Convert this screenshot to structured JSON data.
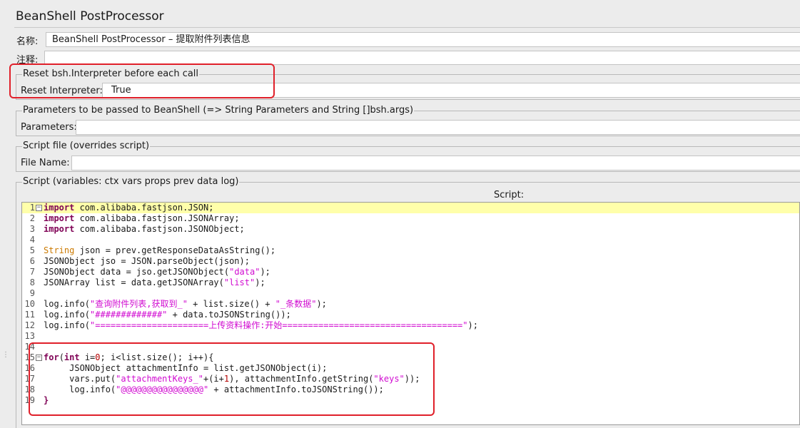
{
  "panel": {
    "title": "BeanShell PostProcessor"
  },
  "name_field": {
    "label": "名称:",
    "value": "BeanShell PostProcessor – 提取附件列表信息"
  },
  "comment_field": {
    "label": "注释:",
    "value": ""
  },
  "reset_group": {
    "title": "Reset bsh.Interpreter before each call",
    "label": "Reset Interpreter:",
    "value": "True"
  },
  "params_group": {
    "title": "Parameters to be passed to BeanShell (=> String Parameters and String []bsh.args)",
    "label": "Parameters:",
    "value": ""
  },
  "file_group": {
    "title": "Script file (overrides script)",
    "label": "File Name:",
    "value": ""
  },
  "script_group": {
    "title": "Script (variables: ctx vars props prev data log)",
    "script_label": "Script:"
  },
  "script_lines": [
    {
      "n": "1",
      "fold": "⊟",
      "tokens": [
        [
          "kw",
          "import"
        ],
        [
          "t",
          " com.alibaba.fastjson.JSON;"
        ]
      ]
    },
    {
      "n": "2",
      "tokens": [
        [
          "kw",
          "import"
        ],
        [
          "t",
          " com.alibaba.fastjson.JSONArray;"
        ]
      ]
    },
    {
      "n": "3",
      "tokens": [
        [
          "kw",
          "import"
        ],
        [
          "t",
          " com.alibaba.fastjson.JSONObject;"
        ]
      ]
    },
    {
      "n": "4",
      "tokens": []
    },
    {
      "n": "5",
      "tokens": [
        [
          "type",
          "String"
        ],
        [
          "t",
          " json = prev.getResponseDataAsString();"
        ]
      ]
    },
    {
      "n": "6",
      "tokens": [
        [
          "t",
          "JSONObject jso = JSON.parseObject(json);"
        ]
      ]
    },
    {
      "n": "7",
      "tokens": [
        [
          "t",
          "JSONObject data = jso.getJSONObject("
        ],
        [
          "str",
          "\"data\""
        ],
        [
          "t",
          ");"
        ]
      ]
    },
    {
      "n": "8",
      "tokens": [
        [
          "t",
          "JSONArray list = data.getJSONArray("
        ],
        [
          "str",
          "\"list\""
        ],
        [
          "t",
          ");"
        ]
      ]
    },
    {
      "n": "9",
      "tokens": []
    },
    {
      "n": "10",
      "tokens": [
        [
          "t",
          "log.info("
        ],
        [
          "str",
          "\"查询附件列表,获取到_\""
        ],
        [
          "t",
          " + list.size() + "
        ],
        [
          "str",
          "\"_条数据\""
        ],
        [
          "t",
          ");"
        ]
      ]
    },
    {
      "n": "11",
      "tokens": [
        [
          "t",
          "log.info("
        ],
        [
          "str",
          "\"#############\""
        ],
        [
          "t",
          " + data.toJSONString());"
        ]
      ]
    },
    {
      "n": "12",
      "tokens": [
        [
          "t",
          "log.info("
        ],
        [
          "str",
          "\"======================上传资料操作:开始===================================\""
        ],
        [
          "t",
          ");"
        ]
      ]
    },
    {
      "n": "13",
      "tokens": []
    },
    {
      "n": "14",
      "tokens": []
    },
    {
      "n": "15",
      "fold": "⊟",
      "tokens": [
        [
          "kw",
          "for"
        ],
        [
          "t",
          "("
        ],
        [
          "kw",
          "int"
        ],
        [
          "t",
          " i="
        ],
        [
          "num",
          "0"
        ],
        [
          "t",
          "; i<list.size(); i++){"
        ]
      ]
    },
    {
      "n": "16",
      "tokens": [
        [
          "t",
          "     JSONObject attachmentInfo = list.getJSONObject(i);"
        ]
      ]
    },
    {
      "n": "17",
      "tokens": [
        [
          "t",
          "     vars.put("
        ],
        [
          "str",
          "\"attachmentKeys_\""
        ],
        [
          "t",
          "+(i+"
        ],
        [
          "num",
          "1"
        ],
        [
          "t",
          "), attachmentInfo.getString("
        ],
        [
          "str",
          "\"keys\""
        ],
        [
          "t",
          "));"
        ]
      ]
    },
    {
      "n": "18",
      "tokens": [
        [
          "t",
          "     log.info("
        ],
        [
          "str",
          "\"@@@@@@@@@@@@@@@@\""
        ],
        [
          "t",
          " + attachmentInfo.toJSONString());"
        ]
      ]
    },
    {
      "n": "19",
      "tokens": [
        [
          "kw",
          "}"
        ]
      ]
    }
  ]
}
